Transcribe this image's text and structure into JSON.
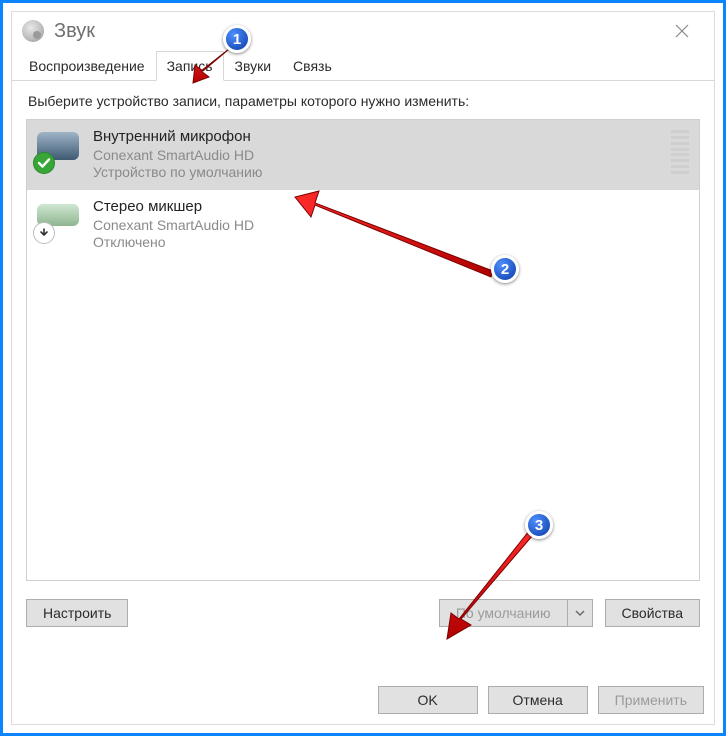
{
  "window": {
    "title": "Звук"
  },
  "tabs": [
    {
      "label": "Воспроизведение"
    },
    {
      "label": "Запись"
    },
    {
      "label": "Звуки"
    },
    {
      "label": "Связь"
    }
  ],
  "instruction": "Выберите устройство записи, параметры которого нужно изменить:",
  "devices": [
    {
      "name": "Внутренний микрофон",
      "driver": "Conexant SmartAudio HD",
      "status": "Устройство по умолчанию"
    },
    {
      "name": "Стерео микшер",
      "driver": "Conexant SmartAudio HD",
      "status": "Отключено"
    }
  ],
  "buttons": {
    "configure": "Настроить",
    "set_default": "По умолчанию",
    "properties": "Свойства",
    "ok": "OK",
    "cancel": "Отмена",
    "apply": "Применить"
  },
  "callouts": {
    "c1": "1",
    "c2": "2",
    "c3": "3"
  }
}
